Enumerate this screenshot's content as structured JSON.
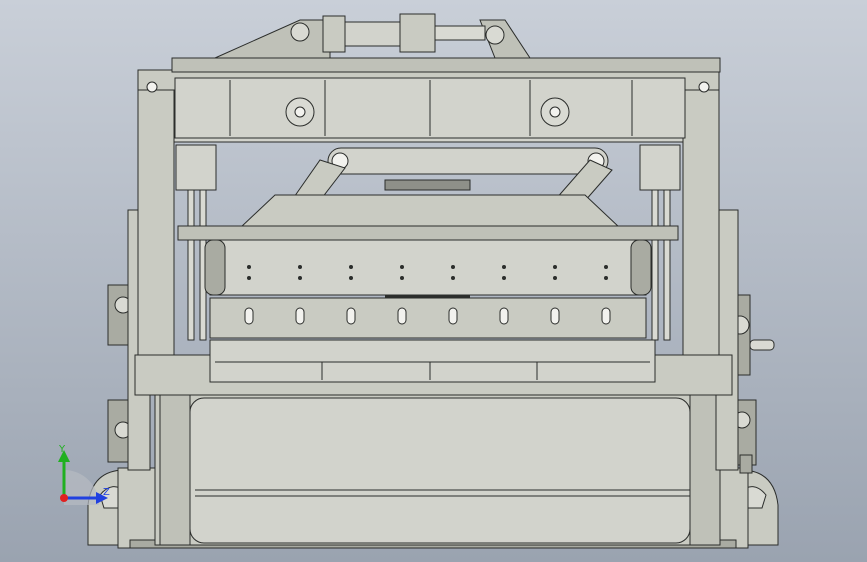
{
  "viewport": {
    "background_top": "#c9cfd8",
    "background_bottom": "#9aa3b0"
  },
  "model": {
    "fill": "#c9cbc2",
    "fill_light": "#d9dad3",
    "fill_dark": "#a9aba2",
    "stroke": "#2b2d2b"
  },
  "triad": {
    "x_color": "#e02020",
    "y_color": "#20b020",
    "z_color": "#2040e0",
    "y_label": "Y",
    "z_label": "Z"
  }
}
